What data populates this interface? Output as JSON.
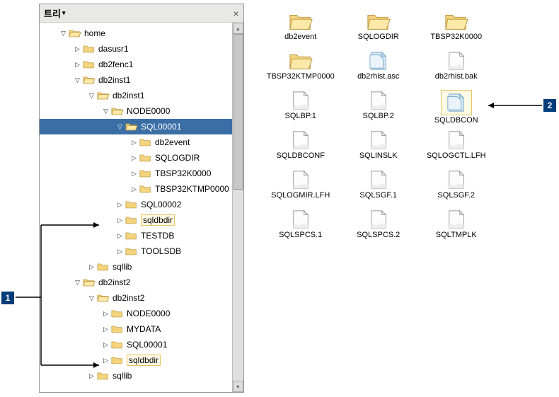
{
  "tree": {
    "title": "트리",
    "nodes": [
      {
        "indent": 1,
        "expander": "▽",
        "icon": "folder-open",
        "label": "home"
      },
      {
        "indent": 2,
        "expander": "▷",
        "icon": "folder-closed",
        "label": "dasusr1"
      },
      {
        "indent": 2,
        "expander": "▷",
        "icon": "folder-closed",
        "label": "db2fenc1"
      },
      {
        "indent": 2,
        "expander": "▽",
        "icon": "folder-open",
        "label": "db2inst1"
      },
      {
        "indent": 3,
        "expander": "▽",
        "icon": "folder-open",
        "label": "db2inst1"
      },
      {
        "indent": 4,
        "expander": "▽",
        "icon": "folder-open",
        "label": "NODE0000"
      },
      {
        "indent": 5,
        "expander": "▽",
        "icon": "folder-open",
        "label": "SQL00001",
        "selected": true
      },
      {
        "indent": 6,
        "expander": "▷",
        "icon": "folder-closed",
        "label": "db2event"
      },
      {
        "indent": 6,
        "expander": "▷",
        "icon": "folder-closed",
        "label": "SQLOGDIR"
      },
      {
        "indent": 6,
        "expander": "▷",
        "icon": "folder-closed",
        "label": "TBSP32K0000"
      },
      {
        "indent": 6,
        "expander": "▷",
        "icon": "folder-closed",
        "label": "TBSP32KTMP0000"
      },
      {
        "indent": 5,
        "expander": "▷",
        "icon": "folder-closed",
        "label": "SQL00002"
      },
      {
        "indent": 5,
        "expander": "▷",
        "icon": "folder-closed",
        "label": "sqldbdir",
        "boxed": true
      },
      {
        "indent": 5,
        "expander": "▷",
        "icon": "folder-closed",
        "label": "TESTDB"
      },
      {
        "indent": 5,
        "expander": "▷",
        "icon": "folder-closed",
        "label": "TOOLSDB"
      },
      {
        "indent": 3,
        "expander": "▷",
        "icon": "folder-closed",
        "label": "sqllib"
      },
      {
        "indent": 2,
        "expander": "▽",
        "icon": "folder-open",
        "label": "db2inst2"
      },
      {
        "indent": 3,
        "expander": "▽",
        "icon": "folder-open",
        "label": "db2inst2"
      },
      {
        "indent": 4,
        "expander": "▷",
        "icon": "folder-closed",
        "label": "NODE0000"
      },
      {
        "indent": 4,
        "expander": "▷",
        "icon": "folder-closed",
        "label": "MYDATA"
      },
      {
        "indent": 4,
        "expander": "▷",
        "icon": "folder-closed",
        "label": "SQL00001"
      },
      {
        "indent": 4,
        "expander": "▷",
        "icon": "folder-closed",
        "label": "sqldbdir",
        "boxed": true
      },
      {
        "indent": 3,
        "expander": "▷",
        "icon": "folder-closed",
        "label": "sqllib"
      }
    ]
  },
  "files": [
    {
      "icon": "folder",
      "label": "db2event"
    },
    {
      "icon": "folder",
      "label": "SQLOGDIR"
    },
    {
      "icon": "folder",
      "label": "TBSP32K0000"
    },
    {
      "icon": "folder",
      "label": "TBSP32KTMP0000"
    },
    {
      "icon": "file-blue",
      "label": "db2rhist.asc"
    },
    {
      "icon": "file",
      "label": "db2rhist.bak"
    },
    {
      "icon": "file",
      "label": "SQLBP.1"
    },
    {
      "icon": "file",
      "label": "SQLBP.2"
    },
    {
      "icon": "file-blue",
      "label": "SQLDBCON",
      "boxed": true
    },
    {
      "icon": "file",
      "label": "SQLDBCONF"
    },
    {
      "icon": "file",
      "label": "SQLINSLK"
    },
    {
      "icon": "file",
      "label": "SQLOGCTL.LFH"
    },
    {
      "icon": "file",
      "label": "SQLOGMIR.LFH"
    },
    {
      "icon": "file",
      "label": "SQLSGF.1"
    },
    {
      "icon": "file",
      "label": "SQLSGF.2"
    },
    {
      "icon": "file",
      "label": "SQLSPCS.1"
    },
    {
      "icon": "file",
      "label": "SQLSPCS.2"
    },
    {
      "icon": "file",
      "label": "SQLTMPLK"
    }
  ],
  "callouts": {
    "left": "1",
    "right": "2"
  }
}
